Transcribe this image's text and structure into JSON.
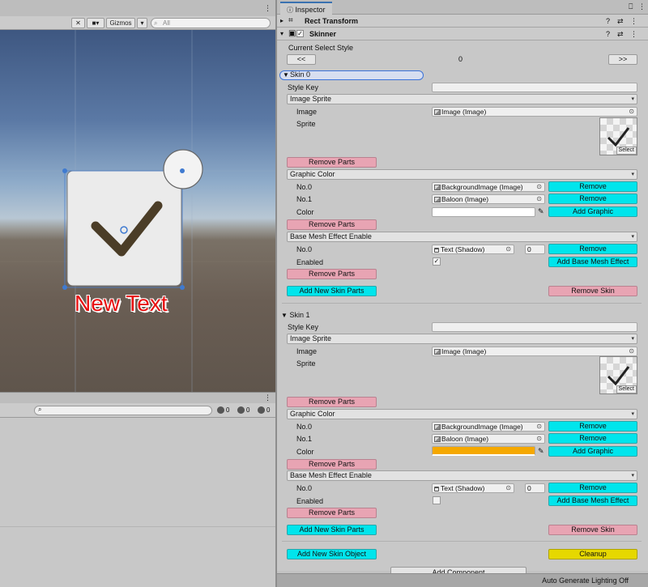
{
  "scene": {
    "gizmos_label": "Gizmos",
    "search_placeholder": "All",
    "new_text_label": "New Text"
  },
  "console": {
    "counts": {
      "info": "0",
      "warn": "0",
      "error": "0"
    }
  },
  "inspector": {
    "tab_label": "Inspector",
    "rect_transform_title": "Rect Transform",
    "skinner_title": "Skinner",
    "current_select_style_label": "Current Select Style",
    "prev_label": "<<",
    "next_label": ">>",
    "current_index": "0",
    "skins": [
      {
        "title": "Skin 0",
        "style_key_label": "Style Key",
        "style_key_value": "",
        "image_sprite": {
          "header": "Image Sprite",
          "image_label": "Image",
          "image_value": "Image (Image)",
          "sprite_label": "Sprite",
          "select_label": "Select",
          "remove_parts_label": "Remove Parts"
        },
        "graphic_color": {
          "header": "Graphic Color",
          "rows": [
            {
              "label": "No.0",
              "value": "BackgroundImage (Image)",
              "button": "Remove"
            },
            {
              "label": "No.1",
              "value": "Baloon (Image)",
              "button": "Remove"
            }
          ],
          "color_label": "Color",
          "color_value": "#ffffff",
          "add_graphic_label": "Add Graphic",
          "remove_parts_label": "Remove Parts"
        },
        "base_mesh": {
          "header": "Base Mesh Effect Enable",
          "row_label": "No.0",
          "row_value": "Text (Shadow)",
          "row_index": "0",
          "row_button": "Remove",
          "enabled_label": "Enabled",
          "enabled_checked": true,
          "enabled_mark": "✓",
          "add_label": "Add Base Mesh Effect",
          "remove_parts_label": "Remove Parts"
        },
        "add_new_skin_parts_label": "Add New Skin Parts",
        "remove_skin_label": "Remove Skin"
      },
      {
        "title": "Skin 1",
        "style_key_label": "Style Key",
        "style_key_value": "",
        "image_sprite": {
          "header": "Image Sprite",
          "image_label": "Image",
          "image_value": "Image (Image)",
          "sprite_label": "Sprite",
          "select_label": "Select",
          "remove_parts_label": "Remove Parts"
        },
        "graphic_color": {
          "header": "Graphic Color",
          "rows": [
            {
              "label": "No.0",
              "value": "BackgroundImage (Image)",
              "button": "Remove"
            },
            {
              "label": "No.1",
              "value": "Baloon (Image)",
              "button": "Remove"
            }
          ],
          "color_label": "Color",
          "color_value": "#f5a800",
          "add_graphic_label": "Add Graphic",
          "remove_parts_label": "Remove Parts"
        },
        "base_mesh": {
          "header": "Base Mesh Effect Enable",
          "row_label": "No.0",
          "row_value": "Text (Shadow)",
          "row_index": "0",
          "row_button": "Remove",
          "enabled_label": "Enabled",
          "enabled_checked": false,
          "enabled_mark": "",
          "add_label": "Add Base Mesh Effect",
          "remove_parts_label": "Remove Parts"
        },
        "add_new_skin_parts_label": "Add New Skin Parts",
        "remove_skin_label": "Remove Skin"
      }
    ],
    "add_new_skin_object_label": "Add New Skin Object",
    "cleanup_label": "Cleanup",
    "add_component_label": "Add Component"
  },
  "status_bar": {
    "text": "Auto Generate Lighting Off"
  },
  "colors": {
    "accent_pink": "#e8a4b3",
    "accent_cyan": "#00e5ec",
    "accent_yellow": "#e6d800",
    "skin1_color": "#f5a800"
  }
}
